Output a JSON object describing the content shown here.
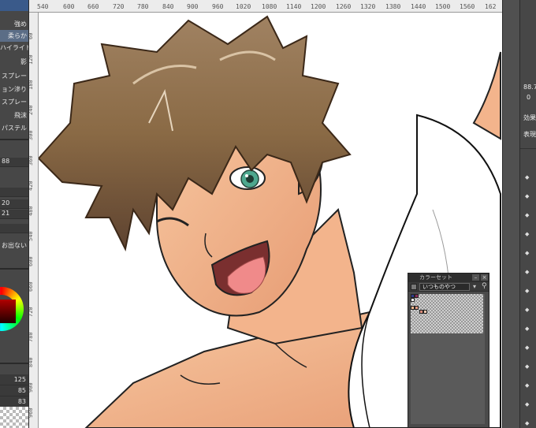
{
  "left_panel": {
    "sub_tools": [
      "強め",
      "柔らか",
      "ハイライト",
      "影",
      "スプレー",
      "ョン滲り",
      "スプレー",
      "飛沫",
      "パステル"
    ],
    "active_index": 1,
    "property_values": [
      "88",
      "20",
      "21"
    ],
    "option_label": "お出ない",
    "rgb": {
      "r": "125",
      "g": "85",
      "b": "83"
    }
  },
  "ruler": {
    "top_labels": [
      "540",
      "600",
      "660",
      "720",
      "780",
      "840",
      "900",
      "960",
      "1020",
      "1080",
      "1140",
      "1200",
      "1260",
      "1320",
      "1380",
      "1440",
      "1500",
      "1560",
      "162"
    ],
    "left_labels": [
      "60",
      "120",
      "180",
      "240",
      "300",
      "360",
      "420",
      "480",
      "540",
      "600",
      "660",
      "720",
      "780",
      "840",
      "900",
      "960"
    ]
  },
  "right_panel": {
    "opacity_label": "88.7",
    "value_label": "0",
    "effect_label": "効果",
    "display_label": "表現"
  },
  "colorset": {
    "title": "カラーセット",
    "set_name": "いつものやつ"
  },
  "colors": {
    "hair": "#8a6a45",
    "skin": "#f4b98f",
    "eye": "#4ea88f"
  }
}
